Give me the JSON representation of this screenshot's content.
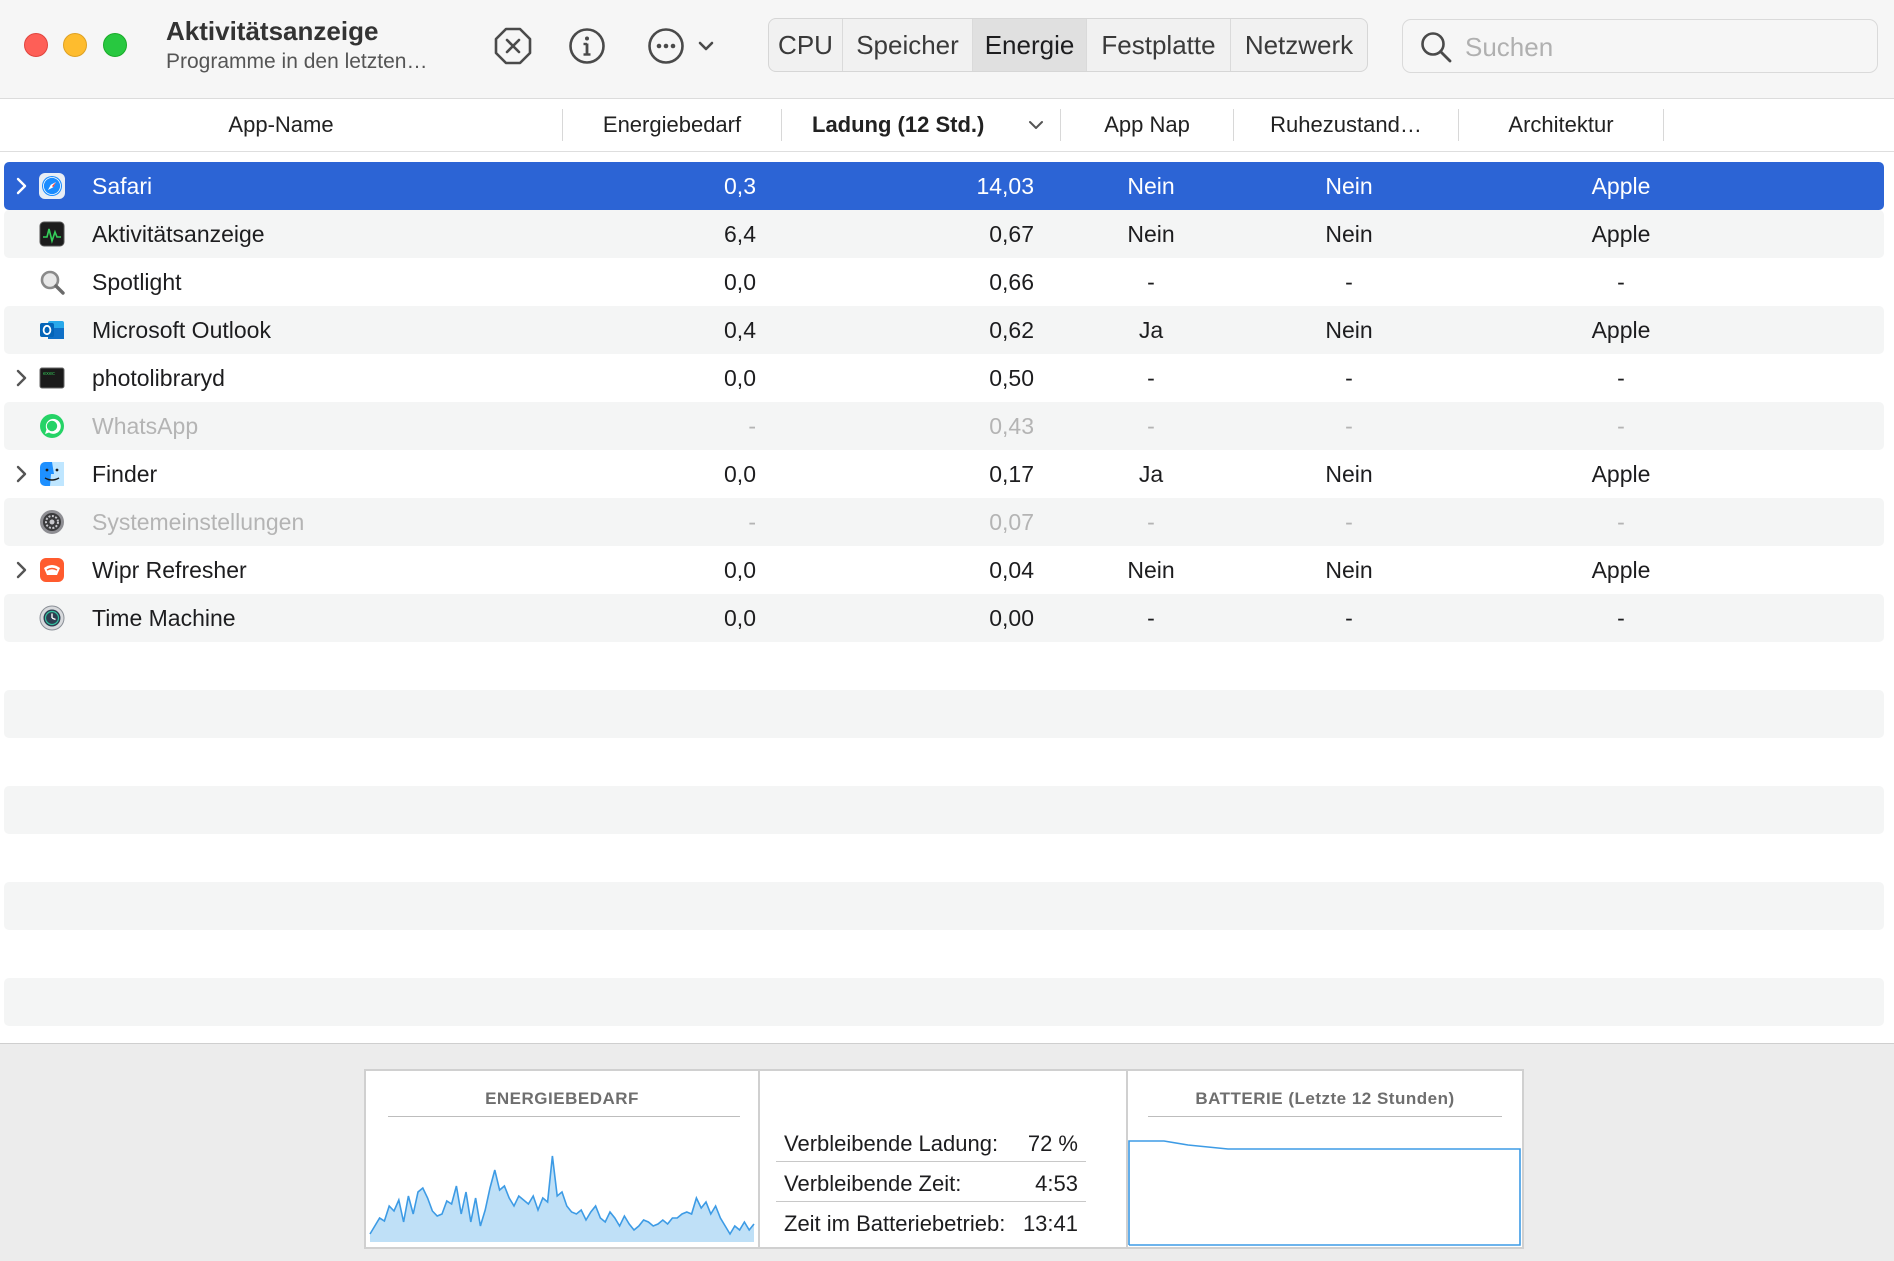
{
  "window": {
    "title": "Aktivitätsanzeige",
    "subtitle": "Programme in den letzten…"
  },
  "toolbar": {
    "stop_icon": "stop-process-icon",
    "info_icon": "info-icon",
    "more_icon": "more-options-icon",
    "tabs": [
      {
        "label": "CPU",
        "active": false
      },
      {
        "label": "Speicher",
        "active": false
      },
      {
        "label": "Energie",
        "active": true
      },
      {
        "label": "Festplatte",
        "active": false
      },
      {
        "label": "Netzwerk",
        "active": false
      }
    ],
    "search_placeholder": "Suchen"
  },
  "columns": {
    "app_name": "App-Name",
    "energy": "Energiebedarf",
    "charge": "Ladung (12 Std.)",
    "app_nap": "App Nap",
    "sleep": "Ruhezustand…",
    "arch": "Architektur",
    "sorted_by": "charge"
  },
  "rows": [
    {
      "name": "Safari",
      "demand": "0,3",
      "charge": "14,03",
      "nap": "Nein",
      "sleep": "Nein",
      "arch": "Apple",
      "expandable": true,
      "selected": true,
      "dim": false,
      "icon": "safari-icon"
    },
    {
      "name": "Aktivitätsanzeige",
      "demand": "6,4",
      "charge": "0,67",
      "nap": "Nein",
      "sleep": "Nein",
      "arch": "Apple",
      "expandable": false,
      "selected": false,
      "dim": false,
      "icon": "activity-monitor-icon"
    },
    {
      "name": "Spotlight",
      "demand": "0,0",
      "charge": "0,66",
      "nap": "-",
      "sleep": "-",
      "arch": "-",
      "expandable": false,
      "selected": false,
      "dim": false,
      "icon": "spotlight-icon"
    },
    {
      "name": "Microsoft Outlook",
      "demand": "0,4",
      "charge": "0,62",
      "nap": "Ja",
      "sleep": "Nein",
      "arch": "Apple",
      "expandable": false,
      "selected": false,
      "dim": false,
      "icon": "outlook-icon"
    },
    {
      "name": "photolibraryd",
      "demand": "0,0",
      "charge": "0,50",
      "nap": "-",
      "sleep": "-",
      "arch": "-",
      "expandable": true,
      "selected": false,
      "dim": false,
      "icon": "terminal-exec-icon"
    },
    {
      "name": "WhatsApp",
      "demand": "-",
      "charge": "0,43",
      "nap": "-",
      "sleep": "-",
      "arch": "-",
      "expandable": false,
      "selected": false,
      "dim": true,
      "icon": "whatsapp-icon"
    },
    {
      "name": "Finder",
      "demand": "0,0",
      "charge": "0,17",
      "nap": "Ja",
      "sleep": "Nein",
      "arch": "Apple",
      "expandable": true,
      "selected": false,
      "dim": false,
      "icon": "finder-icon"
    },
    {
      "name": "Systemeinstellungen",
      "demand": "-",
      "charge": "0,07",
      "nap": "-",
      "sleep": "-",
      "arch": "-",
      "expandable": false,
      "selected": false,
      "dim": true,
      "icon": "system-settings-icon"
    },
    {
      "name": "Wipr Refresher",
      "demand": "0,0",
      "charge": "0,04",
      "nap": "Nein",
      "sleep": "Nein",
      "arch": "Apple",
      "expandable": true,
      "selected": false,
      "dim": false,
      "icon": "wipr-icon"
    },
    {
      "name": "Time Machine",
      "demand": "0,0",
      "charge": "0,00",
      "nap": "-",
      "sleep": "-",
      "arch": "-",
      "expandable": false,
      "selected": false,
      "dim": false,
      "icon": "time-machine-icon"
    }
  ],
  "bottom": {
    "energy_title": "ENERGIEBEDARF",
    "battery_title": "BATTERIE (Letzte 12 Stunden)",
    "stats": [
      {
        "label": "Verbleibende Ladung:",
        "value": "72 %"
      },
      {
        "label": "Verbleibende Zeit:",
        "value": "4:53"
      },
      {
        "label": "Zeit im Batteriebetrieb:",
        "value": "13:41"
      }
    ]
  },
  "colors": {
    "selection": "#2c64d5",
    "graph_fill": "#bfe0f7",
    "graph_line": "#3d9be5"
  }
}
